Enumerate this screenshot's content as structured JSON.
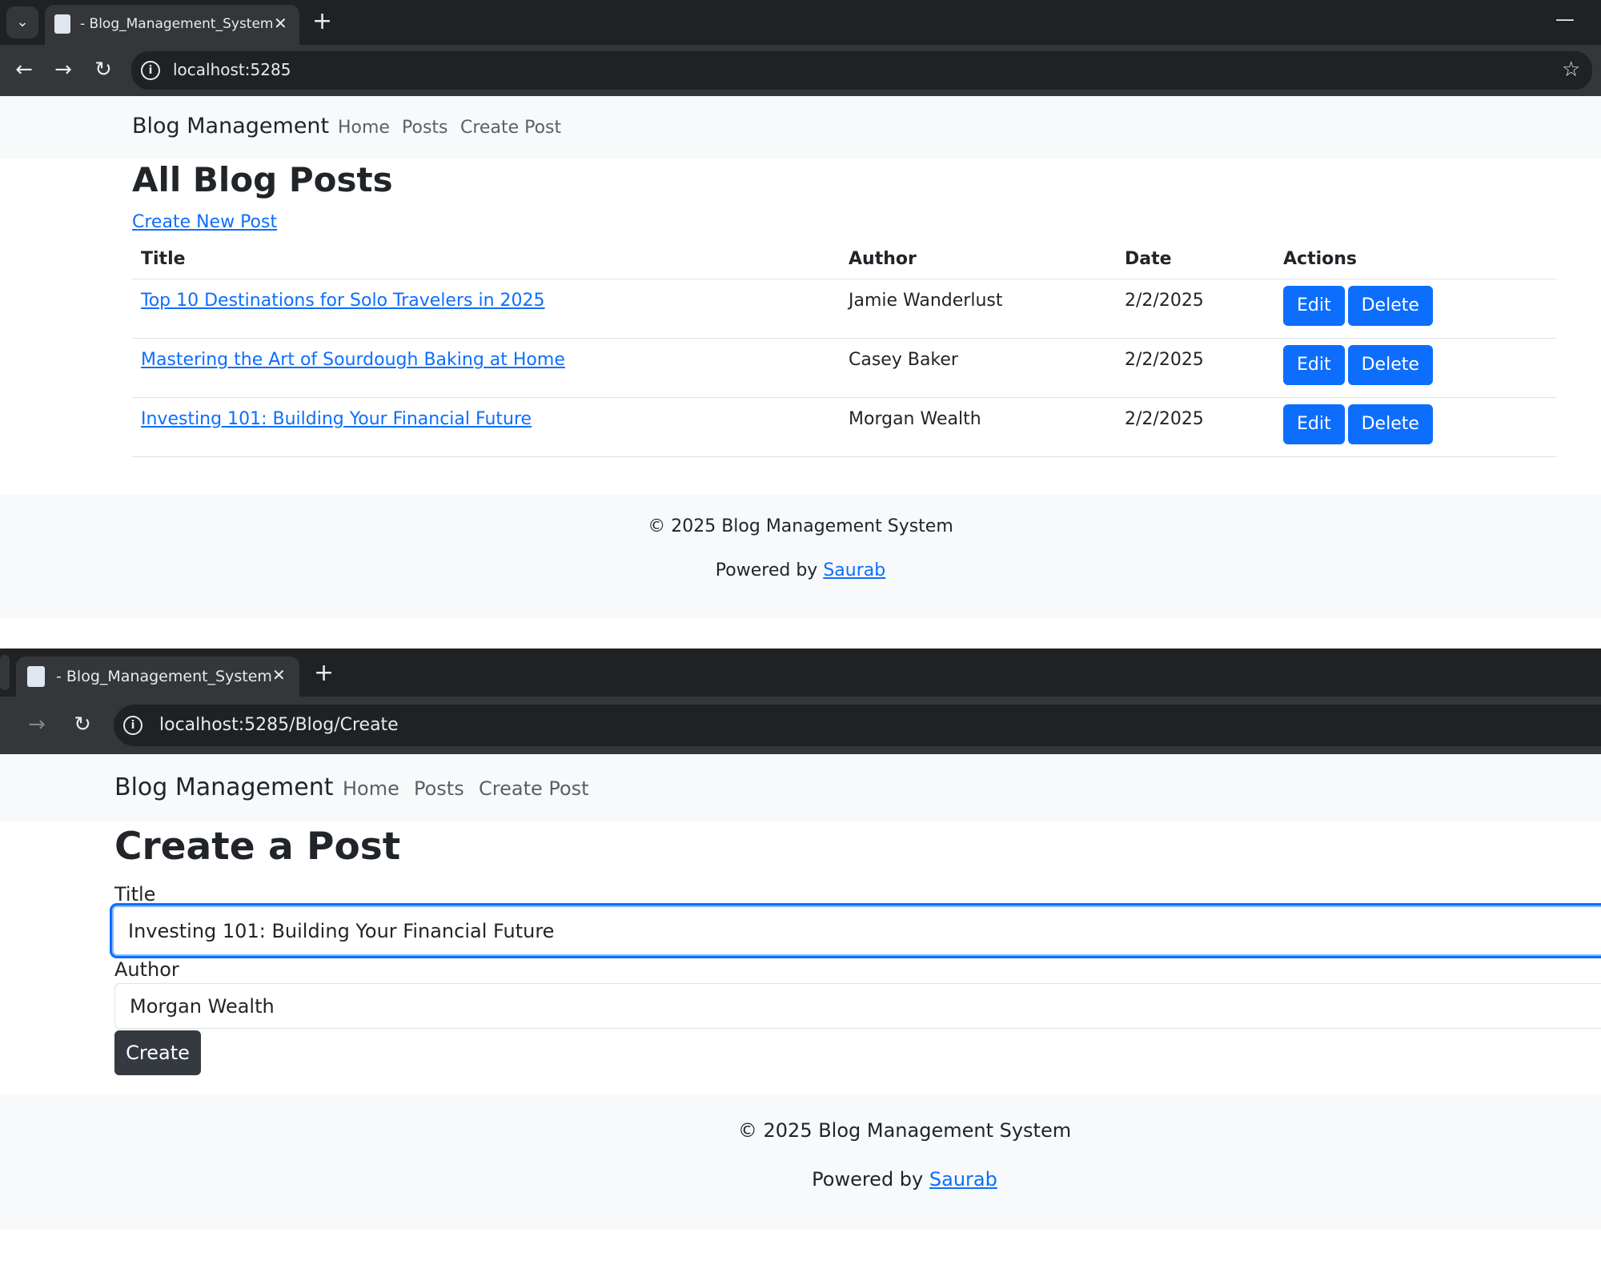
{
  "window1": {
    "tab_title": "- Blog_Management_System",
    "url": "localhost:5285",
    "tab_close": "✕",
    "new_tab": "+",
    "minimize": "—",
    "brand": "Blog Management",
    "nav": [
      "Home",
      "Posts",
      "Create Post"
    ],
    "page_title": "All Blog Posts",
    "create_link": "Create New Post",
    "table": {
      "headers": [
        "Title",
        "Author",
        "Date",
        "Actions"
      ],
      "rows": [
        {
          "title": "Top 10 Destinations for Solo Travelers in 2025",
          "author": "Jamie Wanderlust",
          "date": "2/2/2025"
        },
        {
          "title": "Mastering the Art of Sourdough Baking at Home",
          "author": "Casey Baker",
          "date": "2/2/2025"
        },
        {
          "title": "Investing 101: Building Your Financial Future",
          "author": "Morgan Wealth",
          "date": "2/2/2025"
        }
      ],
      "edit_label": "Edit",
      "delete_label": "Delete"
    },
    "footer": {
      "copyright": "© 2025 Blog Management System",
      "powered_prefix": "Powered by",
      "powered_link": "Saurab"
    }
  },
  "window2": {
    "tab_title": "- Blog_Management_System",
    "url": "localhost:5285/Blog/Create",
    "tab_close": "✕",
    "new_tab": "+",
    "brand": "Blog Management",
    "nav": [
      "Home",
      "Posts",
      "Create Post"
    ],
    "page_title": "Create a Post",
    "form": {
      "title_label": "Title",
      "title_value": "Investing 101: Building Your Financial Future",
      "author_label": "Author",
      "author_value": "Morgan Wealth",
      "submit_label": "Create"
    },
    "footer": {
      "copyright": "© 2025 Blog Management System",
      "powered_prefix": "Powered by",
      "powered_link": "Saurab"
    }
  },
  "colors": {
    "accent": "#0d6efd",
    "navbar_bg": "#f8f9fa",
    "chrome_dark": "#202124",
    "chrome_toolbar": "#35363a",
    "button_dark": "#343a40"
  },
  "icons": [
    "tab-list-icon",
    "page-favicon-icon",
    "back-arrow-icon",
    "forward-arrow-icon",
    "reload-icon",
    "site-info-icon",
    "bookmark-star-icon",
    "minimize-icon"
  ]
}
